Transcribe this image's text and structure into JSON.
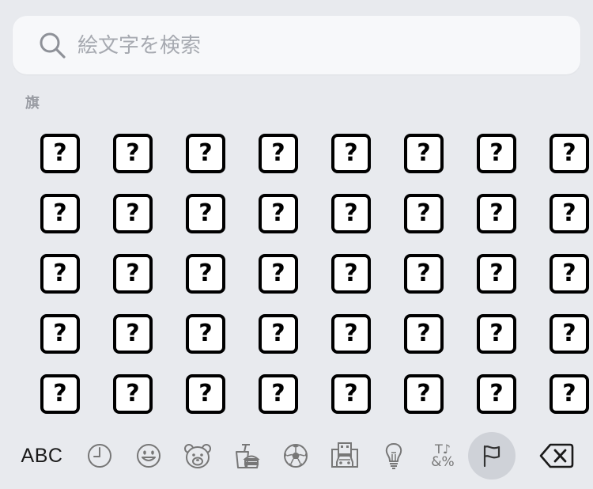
{
  "search": {
    "placeholder": "絵文字を検索"
  },
  "section": {
    "title": "旗"
  },
  "emoji_grid": {
    "rows": 5,
    "columns": 8,
    "glyph": "?"
  },
  "category_bar": {
    "abc_label": "ABC",
    "icons": [
      "clock-icon",
      "smiley-icon",
      "bear-icon",
      "food-icon",
      "soccer-ball-icon",
      "building-car-icon",
      "lightbulb-icon",
      "symbols-icon",
      "flag-icon"
    ],
    "symbols_glyph_top": "T♪",
    "symbols_glyph_bottom": "&%",
    "active": "flag-icon"
  },
  "colors": {
    "background": "#e8eaee",
    "search_bg": "#f7f8fa",
    "active_highlight": "#cfd2d8",
    "icon_gray": "#777777"
  }
}
